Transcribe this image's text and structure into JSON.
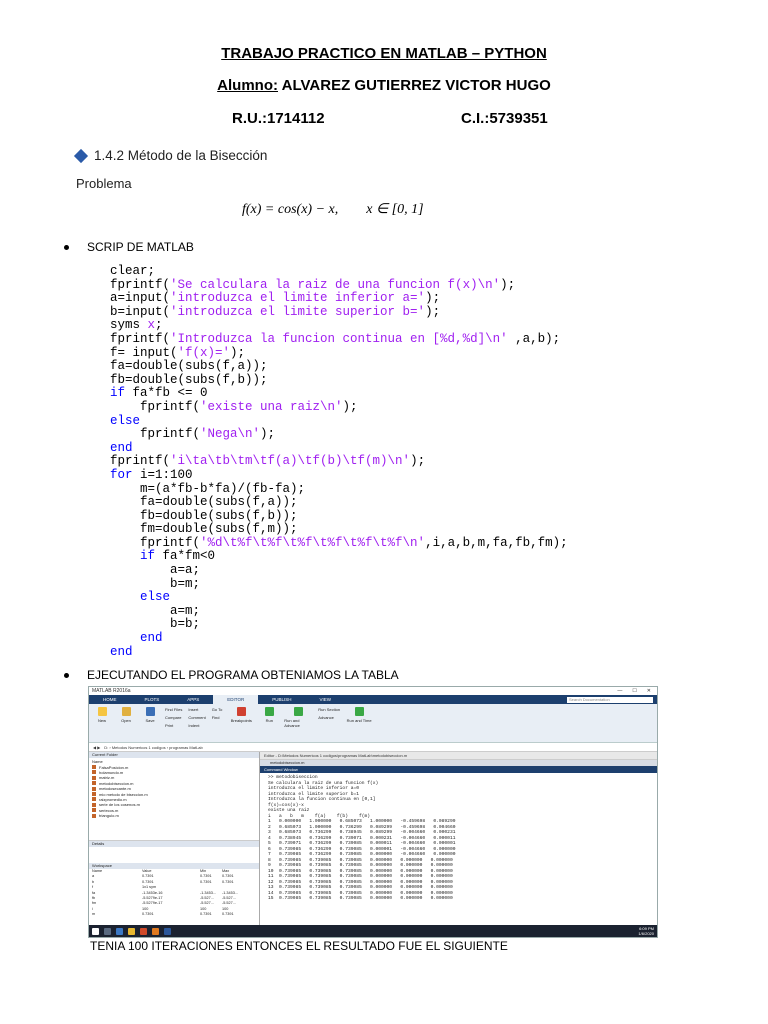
{
  "header": {
    "title": "TRABAJO PRACTICO  EN MATLAB – PYTHON",
    "student_label": "Alumno:",
    "student_name": "ALVAREZ GUTIERREZ VICTOR HUGO",
    "ru": "R.U.:1714112",
    "ci": "C.I.:5739351"
  },
  "section": {
    "heading": "1.4.2 Método de la Bisección",
    "problem_label": "Problema",
    "formula": "f(x) = cos(x) − x,        x ∈ [0, 1]"
  },
  "bullets": {
    "script": "SCRIP DE MATLAB",
    "run": "EJECUTANDO EL PROGRAMA OBTENIAMOS LA TABLA"
  },
  "code_lines": [
    [
      {
        "t": "clear;",
        "c": "n"
      }
    ],
    [
      {
        "t": "fprintf(",
        "c": "n"
      },
      {
        "t": "'Se calculara la raiz de una funcion f(x)\\n'",
        "c": "s"
      },
      {
        "t": ");",
        "c": "n"
      }
    ],
    [
      {
        "t": "a=input(",
        "c": "n"
      },
      {
        "t": "'introduzca el limite inferior a='",
        "c": "s"
      },
      {
        "t": ");",
        "c": "n"
      }
    ],
    [
      {
        "t": "b=input(",
        "c": "n"
      },
      {
        "t": "'introduzca el limite superior b='",
        "c": "s"
      },
      {
        "t": ");",
        "c": "n"
      }
    ],
    [
      {
        "t": "syms ",
        "c": "n"
      },
      {
        "t": "x",
        "c": "s"
      },
      {
        "t": ";",
        "c": "n"
      }
    ],
    [
      {
        "t": "fprintf(",
        "c": "n"
      },
      {
        "t": "'Introduzca la funcion continua en [%d,%d]\\n'",
        "c": "s"
      },
      {
        "t": " ,a,b);",
        "c": "n"
      }
    ],
    [
      {
        "t": "f= input(",
        "c": "n"
      },
      {
        "t": "'f(x)='",
        "c": "s"
      },
      {
        "t": ");",
        "c": "n"
      }
    ],
    [
      {
        "t": "fa=double(subs(f,a));",
        "c": "n"
      }
    ],
    [
      {
        "t": "fb=double(subs(f,b));",
        "c": "n"
      }
    ],
    [
      {
        "t": "if",
        "c": "k"
      },
      {
        "t": " fa*fb <= 0",
        "c": "n"
      }
    ],
    [
      {
        "t": "    fprintf(",
        "c": "n"
      },
      {
        "t": "'existe una raiz\\n'",
        "c": "s"
      },
      {
        "t": ");",
        "c": "n"
      }
    ],
    [
      {
        "t": "else",
        "c": "k"
      }
    ],
    [
      {
        "t": "    fprintf(",
        "c": "n"
      },
      {
        "t": "'Nega\\n'",
        "c": "s"
      },
      {
        "t": ");",
        "c": "n"
      }
    ],
    [
      {
        "t": "end",
        "c": "k"
      }
    ],
    [
      {
        "t": "fprintf(",
        "c": "n"
      },
      {
        "t": "'i\\ta\\tb\\tm\\tf(a)\\tf(b)\\tf(m)\\n'",
        "c": "s"
      },
      {
        "t": ");",
        "c": "n"
      }
    ],
    [
      {
        "t": "for",
        "c": "k"
      },
      {
        "t": " i=1:100",
        "c": "n"
      }
    ],
    [
      {
        "t": "    m=(a*fb-b*fa)/(fb-fa);",
        "c": "n"
      }
    ],
    [
      {
        "t": "    fa=double(subs(f,a));",
        "c": "n"
      }
    ],
    [
      {
        "t": "    fb=double(subs(f,b));",
        "c": "n"
      }
    ],
    [
      {
        "t": "    fm=double(subs(f,m));",
        "c": "n"
      }
    ],
    [
      {
        "t": "    fprintf(",
        "c": "n"
      },
      {
        "t": "'%d\\t%f\\t%f\\t%f\\t%f\\t%f\\t%f\\n'",
        "c": "s"
      },
      {
        "t": ",i,a,b,m,fa,fb,fm);",
        "c": "n"
      }
    ],
    [
      {
        "t": "    ",
        "c": "n"
      },
      {
        "t": "if",
        "c": "k"
      },
      {
        "t": " fa*fm<0",
        "c": "n"
      }
    ],
    [
      {
        "t": "        a=a;",
        "c": "n"
      }
    ],
    [
      {
        "t": "        b=m;",
        "c": "n"
      }
    ],
    [
      {
        "t": "    ",
        "c": "n"
      },
      {
        "t": "else",
        "c": "k"
      }
    ],
    [
      {
        "t": "        a=m;",
        "c": "n"
      }
    ],
    [
      {
        "t": "        b=b;",
        "c": "n"
      }
    ],
    [
      {
        "t": "    ",
        "c": "n"
      },
      {
        "t": "end",
        "c": "k"
      }
    ],
    [
      {
        "t": "end",
        "c": "k"
      }
    ]
  ],
  "colors": {
    "keyword": "#0000ff",
    "string": "#a020f0",
    "matlab_blue": "#1c3f6e"
  },
  "screenshot": {
    "window_title": "MATLAB R2016a",
    "tabs": [
      "HOME",
      "PLOTS",
      "APPS",
      "EDITOR",
      "PUBLISH",
      "VIEW"
    ],
    "active_tab": "EDITOR",
    "search_placeholder": "Search Documentation",
    "toolbar": [
      "New",
      "Open",
      "Save",
      "Breakpoints",
      "Run",
      "Run and Advance",
      "Run and Time"
    ],
    "toolbar_small": [
      "Find Files",
      "Compare",
      "Print",
      "Insert",
      "Comment",
      "Indent",
      "Go To",
      "Find",
      "Run Section",
      "Advance"
    ],
    "address": "D: › Metodos Numericos 1 codigos › programas MatLab",
    "current_folder_label": "Current Folder",
    "files_header": "Name",
    "files": [
      "FalsaPosicion.m",
      "holamundo.m",
      "matriz.m",
      "metodobiseccion.m",
      "metodosecante.m",
      "mio metodo de biseccion.m",
      "raizpromedio.m",
      "serie de los cosenos.m",
      "seriecos.m",
      "triangulo.m"
    ],
    "details_label": "Details",
    "workspace_label": "Workspace",
    "workspace_header": [
      "Name",
      "Value",
      "Min",
      "Max"
    ],
    "workspace_rows": [
      [
        "a",
        "0.7391",
        "0.7391",
        "0.7391"
      ],
      [
        "b",
        "0.7391",
        "0.7391",
        "0.7391"
      ],
      [
        "f",
        "1x1 sym",
        "",
        ""
      ],
      [
        "fa",
        "-1.3453e-16",
        "-1.3453...",
        "-1.3453..."
      ],
      [
        "fb",
        "-5.5279e-17",
        "-5.527...",
        "-5.527..."
      ],
      [
        "fm",
        "-5.5279e-17",
        "-5.527...",
        "-5.527..."
      ],
      [
        "i",
        "100",
        "100",
        "100"
      ],
      [
        "m",
        "0.7391",
        "0.7391",
        "0.7391"
      ]
    ],
    "editor_path": "Editor - D:\\Metodos Numericos 1 codigos\\programas MatLab\\metodobiseccion.m",
    "editor_file_tab": "metodobiseccion.m",
    "command_window_label": "Command Window",
    "console_lines": [
      ">> metodobiseccion",
      "Se calculara la raiz de una funcion f(x)",
      "introduzca el limite inferior a=0",
      "introduzca el limite superior b=1",
      "Introduzca la funcion continua en [0,1]",
      "f(x)=cos(x)-x",
      "existe una raiz",
      "i   a   b   m    f(a)    f(b)    f(m)",
      "1   0.000000   1.000000   0.685073   1.000000   -0.459698   0.089299",
      "2   0.685073   1.000000   0.736299   0.089299   -0.459698   0.004660",
      "3   0.685073   0.736299   0.738945   0.089299   -0.004660   0.000231",
      "4   0.738945   0.736299   0.739071   0.000231   -0.004660   0.000011",
      "5   0.739071   0.736299   0.739085   0.000011   -0.004660   0.000001",
      "6   0.739085   0.736299   0.739085   0.000001   -0.004660   0.000000",
      "7   0.739085   0.736299   0.739085   0.000000   -0.004660   0.000000",
      "8   0.739085   0.739085   0.739085   0.000000   0.000000   0.000000",
      "9   0.739085   0.739085   0.739085   0.000000   0.000000   0.000000",
      "10  0.739085   0.739085   0.739085   0.000000   0.000000   0.000000",
      "11  0.739085   0.739085   0.739085   0.000000   0.000000   0.000000",
      "12  0.739085   0.739085   0.739085   0.000000   0.000000   0.000000",
      "13  0.739085   0.739085   0.739085   0.000000   0.000000   0.000000",
      "14  0.739085   0.739085   0.739085   0.000000   0.000000   0.000000",
      "15  0.739085   0.739085   0.739085   0.000000   0.000000   0.000000"
    ],
    "tray_time": "6:09 PM",
    "tray_date": "1/6/2020"
  },
  "after_text": "TENIA 100 ITERACIONES ENTONCES EL RESULTADO FUE EL SIGUIENTE"
}
